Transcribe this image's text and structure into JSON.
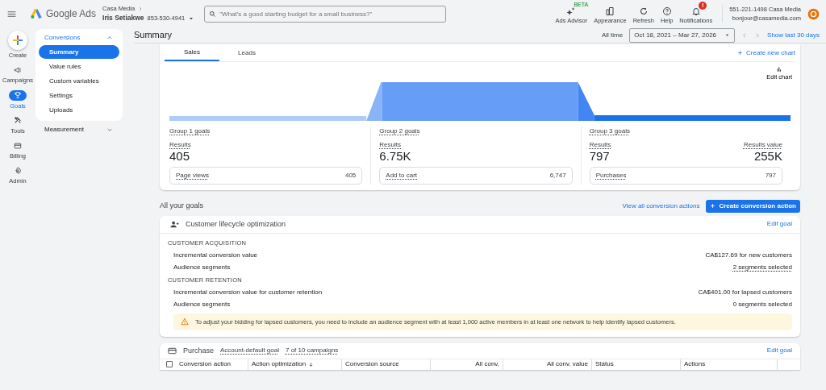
{
  "header": {
    "product": "Google Ads",
    "account": {
      "parent": "Casa Media",
      "name": "Iris Setiakwe",
      "id": "853-530-4941"
    },
    "search": {
      "placeholder": "\"What's a good starting budget for a small business?\""
    },
    "actions": [
      {
        "kind": "advisor",
        "label": "Ads Advisor",
        "badge": "BETA"
      },
      {
        "kind": "appearance",
        "label": "Appearance"
      },
      {
        "kind": "refresh",
        "label": "Refresh"
      },
      {
        "kind": "help",
        "label": "Help"
      },
      {
        "kind": "notifications",
        "label": "Notifications",
        "badge": "!"
      }
    ],
    "user": {
      "line1": "551-221-1498 Casa Media",
      "line2": "bonjour@casamedia.com"
    }
  },
  "rail": [
    {
      "kind": "create",
      "label": "Create",
      "selected": false
    },
    {
      "kind": "campaigns",
      "label": "Campaigns",
      "selected": false
    },
    {
      "kind": "goals",
      "label": "Goals",
      "selected": true
    },
    {
      "kind": "tools",
      "label": "Tools",
      "selected": false
    },
    {
      "kind": "billing",
      "label": "Billing",
      "selected": false
    },
    {
      "kind": "admin",
      "label": "Admin",
      "selected": false
    }
  ],
  "subnav": [
    {
      "label": "Conversions",
      "expanded": true,
      "items": [
        {
          "label": "Summary",
          "selected": true
        },
        {
          "label": "Value rules",
          "selected": false
        },
        {
          "label": "Custom variables",
          "selected": false
        },
        {
          "label": "Settings",
          "selected": false
        },
        {
          "label": "Uploads",
          "selected": false
        }
      ]
    },
    {
      "label": "Measurement",
      "expanded": false
    }
  ],
  "page": {
    "title": "Summary",
    "date_label": "All time",
    "date_range": "Oct 18, 2021 – Mar 27, 2026",
    "show_last": "Show last 30 days"
  },
  "summary_card": {
    "tabs": [
      {
        "label": "Sales",
        "selected": true
      },
      {
        "label": "Leads",
        "selected": false
      }
    ],
    "create_chart": "Create new chart",
    "edit_chart": "Edit chart",
    "groups": [
      {
        "title": "Group 1 goals",
        "metrics": [
          {
            "label": "Results",
            "value": "405"
          }
        ],
        "row": {
          "label": "Page views",
          "value": "405"
        }
      },
      {
        "title": "Group 2 goals",
        "metrics": [
          {
            "label": "Results",
            "value": "6.75K"
          }
        ],
        "row": {
          "label": "Add to cart",
          "value": "6,747"
        }
      },
      {
        "title": "Group 3 goals",
        "metrics": [
          {
            "label": "Results",
            "value": "797"
          },
          {
            "label": "Results value",
            "value": "255K"
          }
        ],
        "row": {
          "label": "Purchases",
          "value": "797"
        }
      }
    ]
  },
  "goals": {
    "title": "All your goals",
    "view_all": "View all conversion actions",
    "create": "Create conversion action",
    "lifecycle": {
      "title": "Customer lifecycle optimization",
      "edit": "Edit goal",
      "sections": [
        {
          "heading": "CUSTOMER ACQUISITION",
          "rows": [
            {
              "label": "Incremental conversion value",
              "value": "CA$127.69 for new customers",
              "dotted": false
            },
            {
              "label": "Audience segments",
              "value": "2 segments selected",
              "dotted": true
            }
          ]
        },
        {
          "heading": "CUSTOMER RETENTION",
          "rows": [
            {
              "label": "Incremental conversion value for customer retention",
              "value": "CA$401.00 for lapsed customers",
              "dotted": false
            },
            {
              "label": "Audience segments",
              "value": "0 segments selected",
              "dotted": false
            }
          ]
        }
      ],
      "warning": "To adjust your bidding for lapsed customers, you need to include an audience segment with at least 1,000 active members in at least one network to help identify lapsed customers."
    },
    "purchase": {
      "title": "Purchase",
      "tags": [
        "Account-default goal",
        "7 of 10 campaigns"
      ],
      "edit": "Edit goal",
      "select_all_checked": false,
      "columns": [
        {
          "label": "Conversion action",
          "kind": "text",
          "sorted": false
        },
        {
          "label": "Action optimization",
          "kind": "text",
          "sorted": true
        },
        {
          "label": "Conversion source",
          "kind": "text",
          "sorted": false
        },
        {
          "label": "All conv.",
          "kind": "number",
          "sorted": false
        },
        {
          "label": "All conv. value",
          "kind": "number",
          "sorted": false
        },
        {
          "label": "Status",
          "kind": "text",
          "sorted": false
        },
        {
          "label": "Actions",
          "kind": "text",
          "sorted": false
        }
      ]
    }
  }
}
